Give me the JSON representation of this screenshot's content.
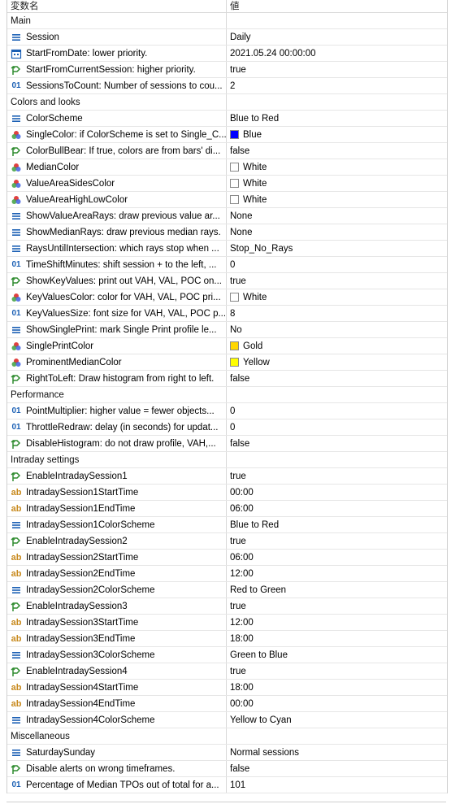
{
  "header": {
    "col_name": "変数名",
    "col_value": "値"
  },
  "rows": [
    {
      "kind": "group",
      "name": "Main"
    },
    {
      "kind": "item",
      "icon": "enum-icon",
      "name": "Session",
      "value": "Daily"
    },
    {
      "kind": "item",
      "icon": "calendar-icon",
      "name": "StartFromDate: lower priority.",
      "value": "2021.05.24 00:00:00"
    },
    {
      "kind": "item",
      "icon": "bool-icon",
      "name": "StartFromCurrentSession: higher priority.",
      "value": "true"
    },
    {
      "kind": "item",
      "icon": "int-icon",
      "name": "SessionsToCount: Number of sessions to cou...",
      "value": "2"
    },
    {
      "kind": "group",
      "name": "Colors and looks"
    },
    {
      "kind": "item",
      "icon": "enum-icon",
      "name": "ColorScheme",
      "value": "Blue to Red"
    },
    {
      "kind": "item",
      "icon": "color-icon",
      "name": "SingleColor: if ColorScheme is set to Single_C...",
      "value": "Blue",
      "swatch": "#0000ff"
    },
    {
      "kind": "item",
      "icon": "bool-icon",
      "name": "ColorBullBear: If true, colors are from bars' di...",
      "value": "false"
    },
    {
      "kind": "item",
      "icon": "color-icon",
      "name": "MedianColor",
      "value": "White",
      "swatch": "#ffffff"
    },
    {
      "kind": "item",
      "icon": "color-icon",
      "name": "ValueAreaSidesColor",
      "value": "White",
      "swatch": "#ffffff"
    },
    {
      "kind": "item",
      "icon": "color-icon",
      "name": "ValueAreaHighLowColor",
      "value": "White",
      "swatch": "#ffffff"
    },
    {
      "kind": "item",
      "icon": "enum-icon",
      "name": "ShowValueAreaRays: draw previous value ar...",
      "value": "None"
    },
    {
      "kind": "item",
      "icon": "enum-icon",
      "name": "ShowMedianRays: draw previous median rays.",
      "value": "None"
    },
    {
      "kind": "item",
      "icon": "enum-icon",
      "name": "RaysUntilIntersection: which rays stop when ...",
      "value": "Stop_No_Rays"
    },
    {
      "kind": "item",
      "icon": "int-icon",
      "name": "TimeShiftMinutes: shift session + to the left, ...",
      "value": "0"
    },
    {
      "kind": "item",
      "icon": "bool-icon",
      "name": "ShowKeyValues: print out VAH, VAL, POC on...",
      "value": "true"
    },
    {
      "kind": "item",
      "icon": "color-icon",
      "name": "KeyValuesColor: color for VAH, VAL, POC pri...",
      "value": "White",
      "swatch": "#ffffff"
    },
    {
      "kind": "item",
      "icon": "int-icon",
      "name": "KeyValuesSize: font size for VAH, VAL, POC p...",
      "value": "8"
    },
    {
      "kind": "item",
      "icon": "enum-icon",
      "name": "ShowSinglePrint: mark Single Print profile le...",
      "value": "No"
    },
    {
      "kind": "item",
      "icon": "color-icon",
      "name": "SinglePrintColor",
      "value": "Gold",
      "swatch": "#ffd700"
    },
    {
      "kind": "item",
      "icon": "color-icon",
      "name": "ProminentMedianColor",
      "value": "Yellow",
      "swatch": "#ffff00"
    },
    {
      "kind": "item",
      "icon": "bool-icon",
      "name": "RightToLeft: Draw histogram from right to left.",
      "value": "false"
    },
    {
      "kind": "group",
      "name": "Performance"
    },
    {
      "kind": "item",
      "icon": "int-icon",
      "name": "PointMultiplier: higher value = fewer objects...",
      "value": "0"
    },
    {
      "kind": "item",
      "icon": "int-icon",
      "name": "ThrottleRedraw: delay (in seconds) for updat...",
      "value": "0"
    },
    {
      "kind": "item",
      "icon": "bool-icon",
      "name": "DisableHistogram: do not draw profile, VAH,...",
      "value": "false"
    },
    {
      "kind": "group",
      "name": "Intraday settings"
    },
    {
      "kind": "item",
      "icon": "bool-icon",
      "name": "EnableIntradaySession1",
      "value": "true"
    },
    {
      "kind": "item",
      "icon": "string-icon",
      "name": "IntradaySession1StartTime",
      "value": "00:00"
    },
    {
      "kind": "item",
      "icon": "string-icon",
      "name": "IntradaySession1EndTime",
      "value": "06:00"
    },
    {
      "kind": "item",
      "icon": "enum-icon",
      "name": "IntradaySession1ColorScheme",
      "value": "Blue to Red"
    },
    {
      "kind": "item",
      "icon": "bool-icon",
      "name": "EnableIntradaySession2",
      "value": "true"
    },
    {
      "kind": "item",
      "icon": "string-icon",
      "name": "IntradaySession2StartTime",
      "value": "06:00"
    },
    {
      "kind": "item",
      "icon": "string-icon",
      "name": "IntradaySession2EndTime",
      "value": "12:00"
    },
    {
      "kind": "item",
      "icon": "enum-icon",
      "name": "IntradaySession2ColorScheme",
      "value": "Red to Green"
    },
    {
      "kind": "item",
      "icon": "bool-icon",
      "name": "EnableIntradaySession3",
      "value": "true"
    },
    {
      "kind": "item",
      "icon": "string-icon",
      "name": "IntradaySession3StartTime",
      "value": "12:00"
    },
    {
      "kind": "item",
      "icon": "string-icon",
      "name": "IntradaySession3EndTime",
      "value": "18:00"
    },
    {
      "kind": "item",
      "icon": "enum-icon",
      "name": "IntradaySession3ColorScheme",
      "value": "Green to Blue"
    },
    {
      "kind": "item",
      "icon": "bool-icon",
      "name": "EnableIntradaySession4",
      "value": "true"
    },
    {
      "kind": "item",
      "icon": "string-icon",
      "name": "IntradaySession4StartTime",
      "value": "18:00"
    },
    {
      "kind": "item",
      "icon": "string-icon",
      "name": "IntradaySession4EndTime",
      "value": "00:00"
    },
    {
      "kind": "item",
      "icon": "enum-icon",
      "name": "IntradaySession4ColorScheme",
      "value": "Yellow to Cyan"
    },
    {
      "kind": "group",
      "name": "Miscellaneous"
    },
    {
      "kind": "item",
      "icon": "enum-icon",
      "name": "SaturdaySunday",
      "value": "Normal sessions"
    },
    {
      "kind": "item",
      "icon": "bool-icon",
      "name": "Disable alerts on wrong timeframes.",
      "value": "false"
    },
    {
      "kind": "item",
      "icon": "int-icon",
      "name": "Percentage of Median TPOs out of total for a...",
      "value": "101"
    }
  ]
}
